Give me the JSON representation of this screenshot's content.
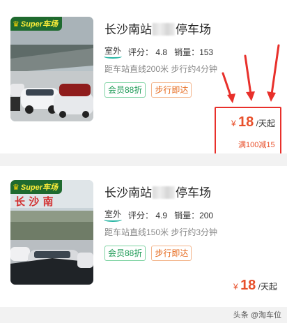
{
  "listings": [
    {
      "badge": "Super车场",
      "title_prefix": "长沙南站",
      "title_suffix": "停车场",
      "environment": "室外",
      "rating_label": "评分：",
      "rating": "4.8",
      "sales_label": "销量：",
      "sales": "153",
      "distance": "距车站直线200米 步行约4分钟",
      "tags": [
        "会员88折",
        "步行即达"
      ],
      "currency": "¥",
      "price": "18",
      "price_unit": "/天起",
      "promo": "满100减15"
    },
    {
      "badge": "Super车场",
      "title_prefix": "长沙南站",
      "title_suffix": "停车场",
      "environment": "室外",
      "rating_label": "评分：",
      "rating": "4.9",
      "sales_label": "销量：",
      "sales": "200",
      "distance": "距车站直线150米 步行约3分钟",
      "tags": [
        "会员88折",
        "步行即达"
      ],
      "currency": "¥",
      "price": "18",
      "price_unit": "/天起",
      "photo_sign_text": "长 沙 南"
    }
  ],
  "watermark": "头条 @淘车位",
  "colors": {
    "accent": "#e8502b",
    "highlight_border": "#e8302b",
    "badge_bg": "#1f6a2f",
    "tag_green": "#1f9b57",
    "tag_orange": "#e66b1f"
  },
  "icons": [
    "crown-icon",
    "red-arrow-icon"
  ]
}
